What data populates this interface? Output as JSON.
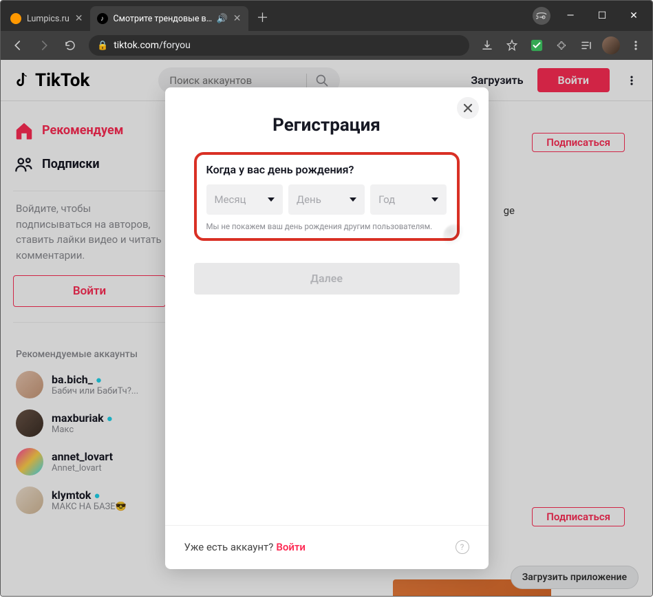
{
  "browser": {
    "tabs": [
      {
        "title": "Lumpics.ru"
      },
      {
        "title": "Смотрите трендовые видео"
      }
    ],
    "url_host": "tiktok.com",
    "url_path": "/foryou"
  },
  "header": {
    "logo_text": "TikTok",
    "search_placeholder": "Поиск аккаунтов",
    "upload": "Загрузить",
    "login": "Войти"
  },
  "sidebar": {
    "nav": {
      "for_you": "Рекомендуем",
      "following": "Подписки"
    },
    "login_prompt": "Войдите, чтобы подписываться на авторов, ставить лайки видео и читать комментарии.",
    "login_button": "Войти",
    "suggested_title": "Рекомендуемые аккаунты",
    "accounts": [
      {
        "name": "ba.bich_",
        "desc": "Бабич или БабиТч?...",
        "verified": true
      },
      {
        "name": "maxburiak",
        "desc": "Макс",
        "verified": true
      },
      {
        "name": "annet_lovart",
        "desc": "Annet_lovart",
        "verified": false
      },
      {
        "name": "klymtok",
        "desc": "МАКС НА БАЗЕ😎",
        "verified": true
      }
    ]
  },
  "feed": {
    "follow": "Подписаться",
    "download_app": "Загрузить приложение",
    "sample_text": "ge"
  },
  "modal": {
    "title": "Регистрация",
    "birthday_label": "Когда у вас день рождения?",
    "month": "Месяц",
    "day": "День",
    "year": "Год",
    "privacy_note": "Мы не покажем ваш день рождения другим пользователям.",
    "next": "Далее",
    "already_have": "Уже есть аккаунт?",
    "login": "Войти"
  }
}
